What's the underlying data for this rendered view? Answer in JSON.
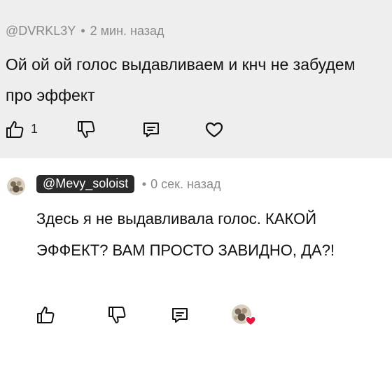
{
  "top_comment": {
    "username": "@DVRKL3Y",
    "separator": "•",
    "time": "2 мин. назад",
    "text": "Ой ой ой голос выдавливаем и кнч не забудем про эффект",
    "likes": "1"
  },
  "reply": {
    "username": "@Mevy_soloist",
    "separator": "•",
    "time": "0 сек. назад",
    "text": "Здесь я не выдавливала голос. КАКОЙ ЭФФЕКТ? ВАМ ПРОСТО ЗАВИДНО, ДА?!"
  },
  "colors": {
    "top_background": "#eeeeee",
    "badge_background": "#2b2b2b",
    "heart": "#e8163c"
  },
  "icons": [
    "thumbs-up-icon",
    "thumbs-down-icon",
    "reply-icon",
    "heart-icon",
    "creator-liked-avatar"
  ]
}
